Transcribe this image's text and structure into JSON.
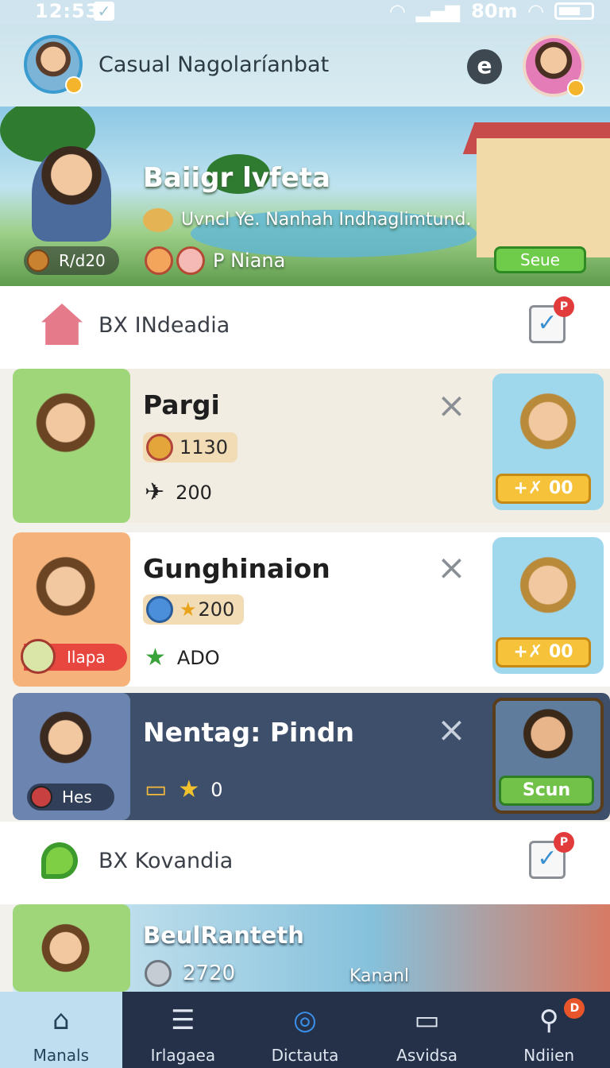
{
  "status_bar": {
    "time": "12:53",
    "right_text": "80m"
  },
  "header": {
    "title": "Casual Nagolaríanbat"
  },
  "hero": {
    "title": "Baiigr lvfeta",
    "subtitle": "Uvncl Ye. Nanhah Indhaglimtund.",
    "left_pill": "R/d20",
    "group_label": "P Niana",
    "button": "Seue"
  },
  "section1": {
    "label": "BX INdeadia",
    "badge": "P"
  },
  "cards": [
    {
      "name": "Pargi",
      "stat": "1130",
      "meta": "200",
      "right_button": "+✗ 00"
    },
    {
      "name": "Gunghinaion",
      "stat": "200",
      "meta": "ADO",
      "ribbon": "Ilapa",
      "right_button": "+✗ 00"
    },
    {
      "name": "Nentag: Pindn",
      "meta": "0",
      "pill": "Hes",
      "right_button": "Scun"
    }
  ],
  "section2": {
    "label": "BX Kovandia",
    "badge": "P"
  },
  "card4": {
    "name": "BeulRanteth",
    "meta": "2720",
    "extra": "Kananl"
  },
  "bottom_nav": [
    {
      "label": "Manals",
      "icon": "home-icon",
      "active": true
    },
    {
      "label": "Irlagaea",
      "icon": "document-icon",
      "active": false
    },
    {
      "label": "Dictauta",
      "icon": "spiral-icon",
      "active": false
    },
    {
      "label": "Asvidsa",
      "icon": "screen-icon",
      "active": false
    },
    {
      "label": "Ndiien",
      "icon": "search-icon",
      "active": false,
      "badge": "D"
    }
  ],
  "colors": {
    "accent_blue": "#3a9bd0",
    "nav_bg": "#243149",
    "nav_active": "#bfdff0",
    "green_button": "#6fcc4a",
    "gold_button": "#f6c23a"
  }
}
